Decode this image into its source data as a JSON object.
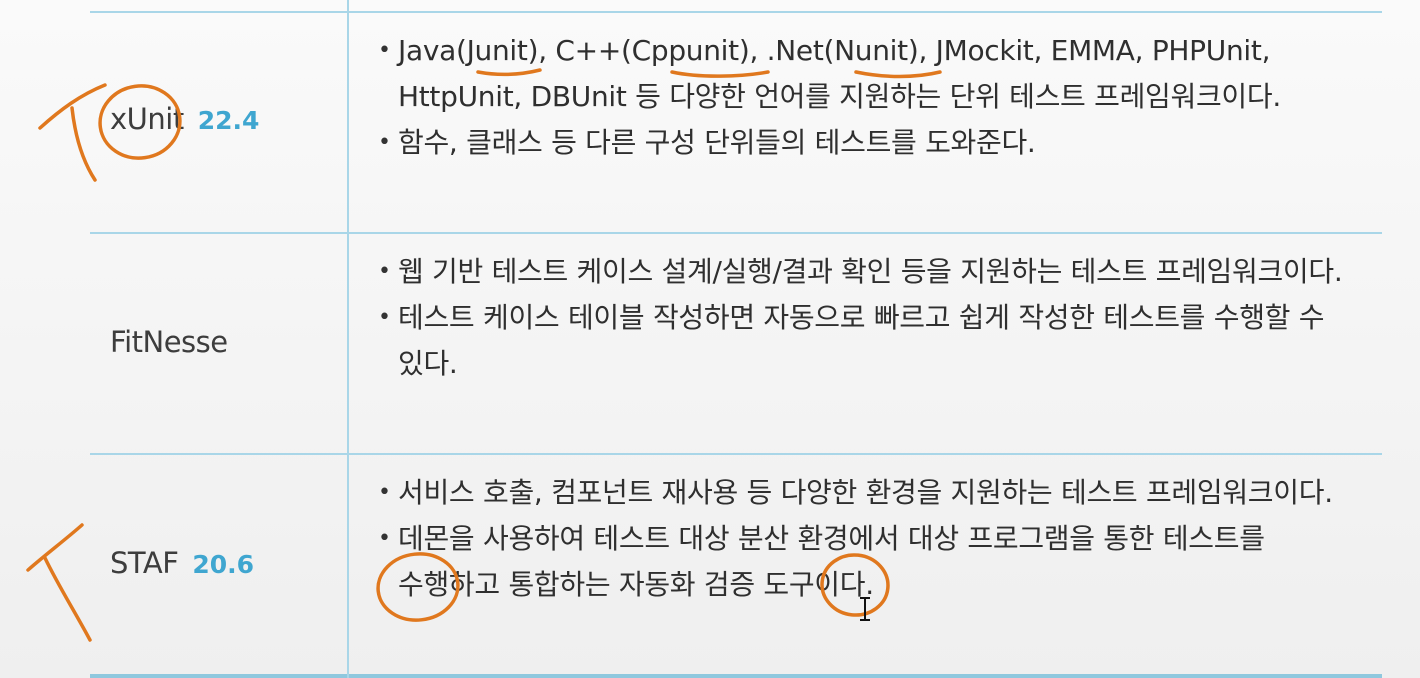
{
  "table": {
    "rows": [
      {
        "name": "xUnit",
        "chapter": "22.4",
        "bullets": [
          "Java(Junit), C++(Cppunit), .Net(Nunit), JMockit, EMMA, PHPUnit, HttpUnit, DBUnit 등 다양한 언어를 지원하는 단위 테스트 프레임워크이다.",
          "함수, 클래스 등 다른 구성 단위들의 테스트를 도와준다."
        ]
      },
      {
        "name": "FitNesse",
        "chapter": "",
        "bullets": [
          "웹 기반 테스트 케이스 설계/실행/결과 확인 등을 지원하는 테스트 프레임워크이다.",
          "테스트 케이스 테이블 작성하면 자동으로 빠르고 쉽게 작성한 테스트를 수행할 수 있다."
        ]
      },
      {
        "name": "STAF",
        "chapter": "20.6",
        "bullets": [
          "서비스 호출, 컴포넌트 재사용 등 다양한 환경을 지원하는 테스트 프레임워크이다.",
          "데몬을 사용하여 테스트 대상 분산 환경에서 대상 프로그램을 통한 테스트를 수행하고 통합하는 자동화 검증 도구이다."
        ]
      }
    ]
  },
  "colors": {
    "table_line": "#a9d6e8",
    "chapter_number": "#3fa6d0",
    "annotation_ink": "#e0781e"
  }
}
